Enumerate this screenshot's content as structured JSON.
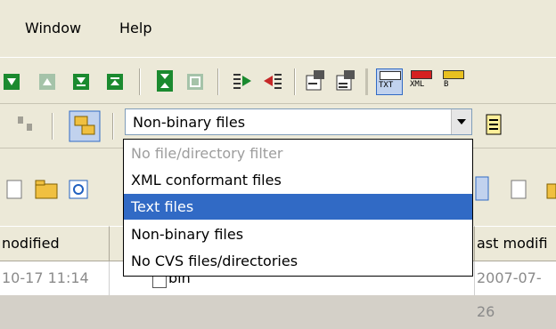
{
  "menu": {
    "window_label": "Window",
    "help_label": "Help"
  },
  "toolbar": {
    "buttons": [
      "next-diff-icon",
      "prev-diff-icon",
      "last-diff-icon",
      "first-diff-icon",
      "next-conflict-icon",
      "prev-conflict-icon",
      "copy-right-icon",
      "copy-left-icon",
      "options-icon",
      "text-compare-icon",
      "txt-view-icon",
      "xml-view-icon",
      "binary-view-icon"
    ],
    "txt_label": "TXT",
    "xml_label": "XML",
    "b_label": "B"
  },
  "filter": {
    "selected": "Non-binary files",
    "options": [
      {
        "label": "No file/directory filter",
        "state": "disabled"
      },
      {
        "label": "XML conformant files",
        "state": "normal"
      },
      {
        "label": "Text files",
        "state": "highlighted"
      },
      {
        "label": "Non-binary files",
        "state": "normal"
      },
      {
        "label": "No CVS files/directories",
        "state": "normal"
      }
    ]
  },
  "columns": {
    "left_header": "nodified",
    "right_header": "ast modifi"
  },
  "rows": {
    "left_date": "10-17 11:14",
    "middle_name": "bin",
    "right_date": "2007-07-26"
  },
  "colors": {
    "selection": "#316ac5",
    "chrome": "#ece9d8",
    "disabled_text": "#9d9d9d"
  }
}
